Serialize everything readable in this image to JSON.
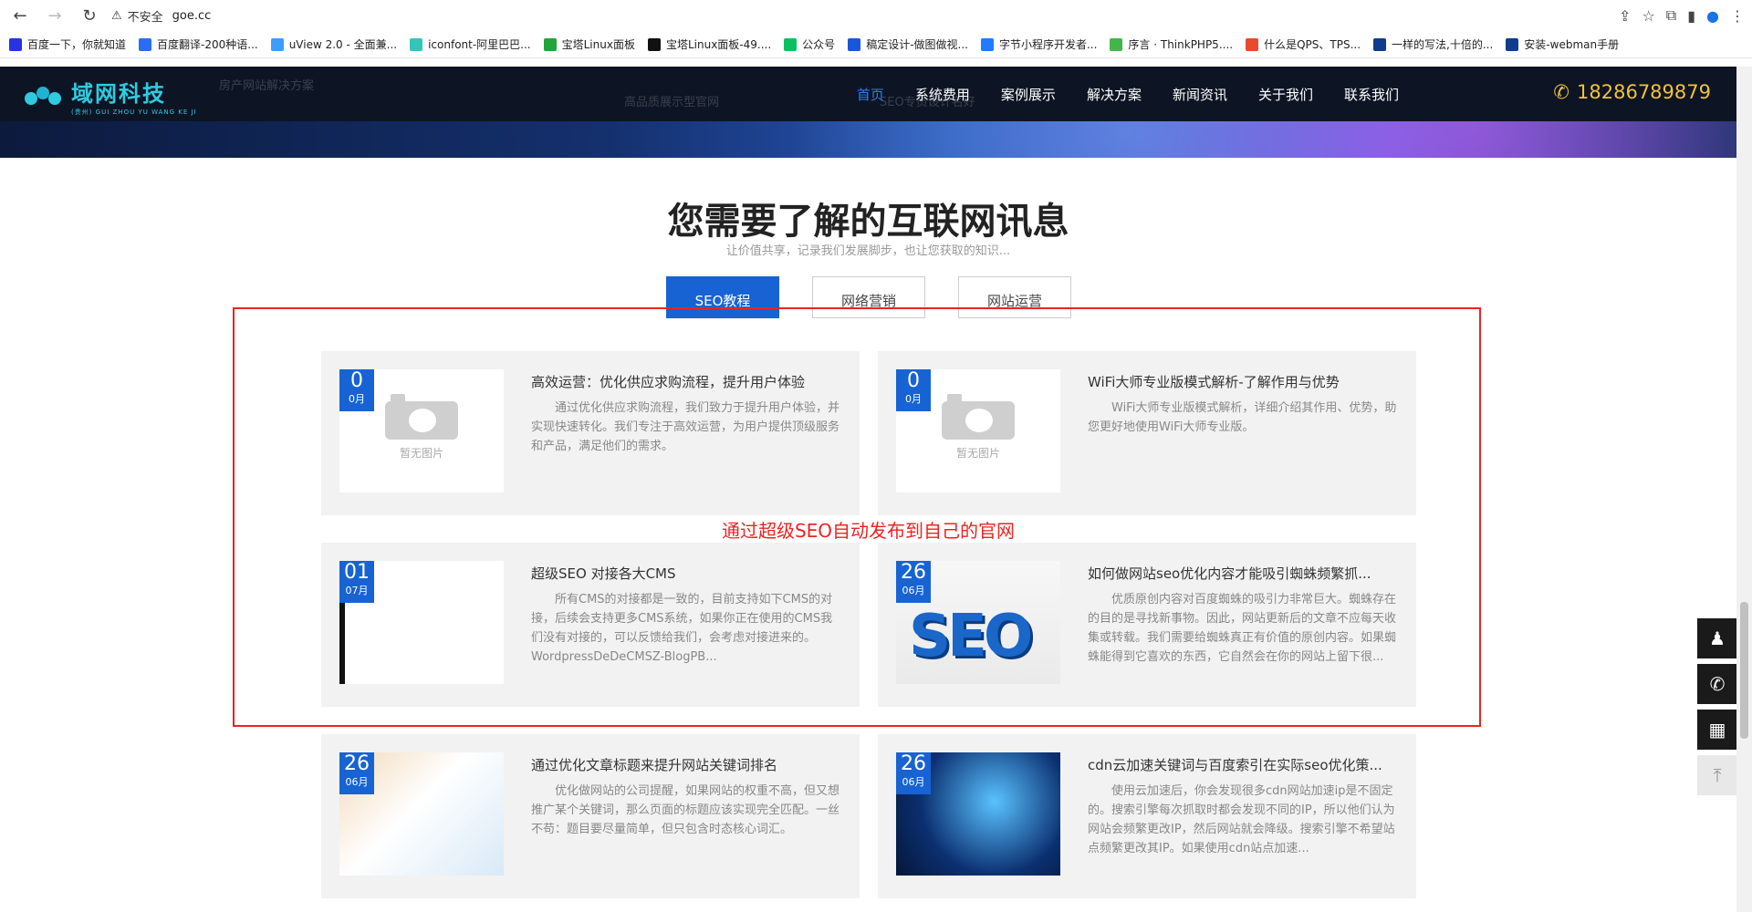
{
  "browser": {
    "security_label": "不安全",
    "url": "goe.cc",
    "bookmarks": [
      {
        "label": "百度一下，你就知道",
        "color": "#2932e1"
      },
      {
        "label": "百度翻译-200种语...",
        "color": "#2a6df4"
      },
      {
        "label": "uView 2.0 - 全面兼...",
        "color": "#3c9cff"
      },
      {
        "label": "iconfont-阿里巴巴...",
        "color": "#33c6b8"
      },
      {
        "label": "宝塔Linux面板",
        "color": "#20a53a"
      },
      {
        "label": "宝塔Linux面板-49....",
        "color": "#111111"
      },
      {
        "label": "公众号",
        "color": "#07c160"
      },
      {
        "label": "稿定设计-做图做视...",
        "color": "#1a56d9"
      },
      {
        "label": "字节小程序开发者...",
        "color": "#1f7bff"
      },
      {
        "label": "序言 · ThinkPHP5....",
        "color": "#44b549"
      },
      {
        "label": "什么是QPS、TPS...",
        "color": "#e84a2c"
      },
      {
        "label": "一样的写法,十倍的...",
        "color": "#0f3c8c"
      },
      {
        "label": "安装-webman手册",
        "color": "#0f3c8c"
      }
    ]
  },
  "site": {
    "logo_cn": "域网科技",
    "logo_en": "(贵州) GUI ZHOU YU WANG KE JI",
    "ghost_texts": [
      "房产网站解决方案",
      "高品质展示型官网",
      "SEO专员设计名好"
    ],
    "nav": [
      "首页",
      "系统费用",
      "案例展示",
      "解决方案",
      "新闻资讯",
      "关于我们",
      "联系我们"
    ],
    "phone": "18286789879"
  },
  "section": {
    "title": "您需要了解的互联网讯息",
    "subtitle": "让价值共享，记录我们发展脚步，也让您获取的知识...",
    "tabs": [
      "SEO教程",
      "网络营销",
      "网站运营"
    ],
    "note": "通过超级SEO自动发布到自己的官网"
  },
  "articles": [
    {
      "day": "0",
      "month": "0月",
      "noimg": "暂无图片",
      "title": "高效运营：优化供应求购流程，提升用户体验",
      "desc": "通过优化供应求购流程，我们致力于提升用户体验，并实现快速转化。我们专注于高效运营，为用户提供顶级服务和产品，满足他们的需求。"
    },
    {
      "day": "0",
      "month": "0月",
      "noimg": "暂无图片",
      "title": "WiFi大师专业版模式解析-了解作用与优势",
      "desc": "WiFi大师专业版模式解析，详细介绍其作用、优势，助您更好地使用WiFi大师专业版。"
    },
    {
      "day": "01",
      "month": "07月",
      "title": "超级SEO 对接各大CMS",
      "desc": "所有CMS的对接都是一致的，目前支持如下CMS的对接，后续会支持更多CMS系统，如果你正在使用的CMS我们没有对接的，可以反馈给我们，会考虑对接进来的。WordpressDeDeCMSZ-BlogPB..."
    },
    {
      "day": "26",
      "month": "06月",
      "image_text": "SEO",
      "title": "如何做网站seo优化内容才能吸引蜘蛛频繁抓...",
      "desc": "优质原创内容对百度蜘蛛的吸引力非常巨大。蜘蛛存在的目的是寻找新事物。因此，网站更新后的文章不应每天收集或转载。我们需要给蜘蛛真正有价值的原创内容。如果蜘蛛能得到它喜欢的东西，它自然会在你的网站上留下很..."
    },
    {
      "day": "26",
      "month": "06月",
      "title": "通过优化文章标题来提升网站关键词排名",
      "desc": "优化做网站的公司提醒，如果网站的权重不高，但又想推广某个关键词，那么页面的标题应该实现完全匹配。一丝不苟：题目要尽量简单，但只包含时态核心词汇。"
    },
    {
      "day": "26",
      "month": "06月",
      "title": "cdn云加速关键词与百度索引在实际seo优化策...",
      "desc": "使用云加速后，你会发现很多cdn网站加速ip是不固定的。搜索引擎每次抓取时都会发现不同的IP，所以他们认为网站会频繁更改IP，然后网站就会降级。搜索引擎不希望站点频繁更改其IP。如果使用cdn站点加速..."
    }
  ]
}
